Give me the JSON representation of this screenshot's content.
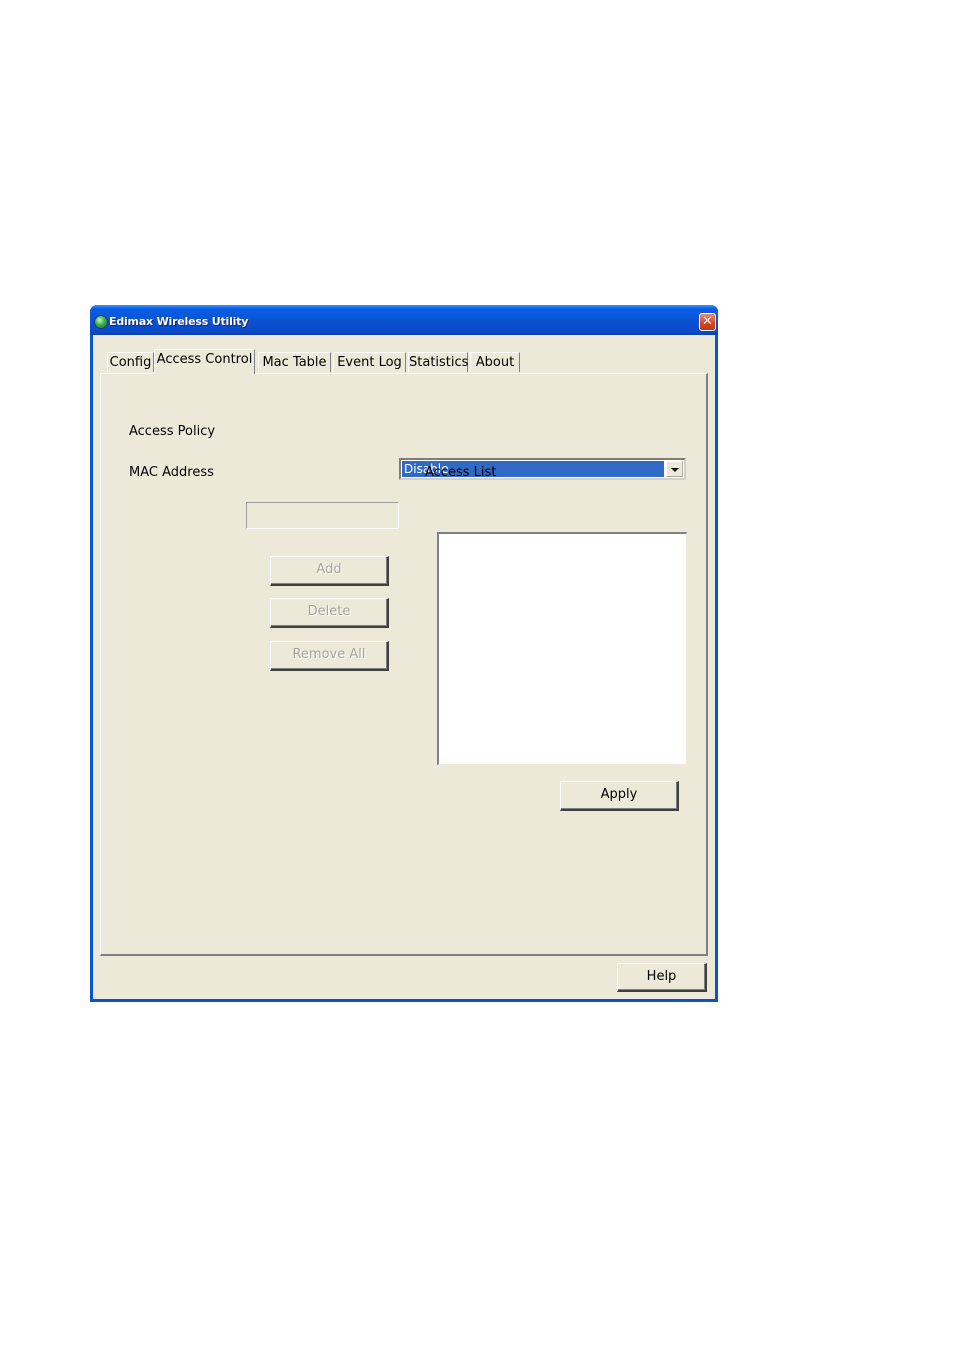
{
  "window": {
    "title": "Edimax Wireless Utility",
    "close_symbol": "✕"
  },
  "tabs": [
    {
      "label": "Config",
      "active": false
    },
    {
      "label": "Access Control",
      "active": true
    },
    {
      "label": "Mac Table",
      "active": false
    },
    {
      "label": "Event Log",
      "active": false
    },
    {
      "label": "Statistics",
      "active": false
    },
    {
      "label": "About",
      "active": false
    }
  ],
  "access_control": {
    "access_policy_label": "Access Policy",
    "access_policy_value": "Disable",
    "mac_address_label": "MAC Address",
    "mac_address_value": "",
    "access_list_label": "Access List",
    "access_list_items": [],
    "add_label": "Add",
    "delete_label": "Delete",
    "remove_all_label": "Remove All",
    "apply_label": "Apply"
  },
  "footer": {
    "help_label": "Help"
  },
  "icons": {
    "app": "edimax-app-icon",
    "close": "close-icon",
    "dropdown": "chevron-down-icon"
  }
}
